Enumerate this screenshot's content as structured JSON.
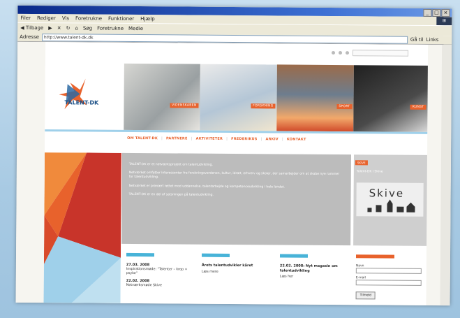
{
  "browser": {
    "menu": [
      "Filer",
      "Rediger",
      "Vis",
      "Foretrukne",
      "Funktioner",
      "Hjælp"
    ],
    "toolbar": [
      "Tilbage",
      "Søg",
      "Foretrukne",
      "Medie"
    ],
    "address_label": "Adresse",
    "address": "http://www.talent-dk.dk",
    "go": "Gå til",
    "links": "Links"
  },
  "logo": {
    "text": "TALENT-DK"
  },
  "banner": {
    "tags": [
      "VIDENSKABEN",
      "FORSKNING",
      "SPORT",
      "KUNST"
    ]
  },
  "nav": [
    "OM TALENT-DK",
    "PARTNERE",
    "AKTIVITETER",
    "FREDERIKUS",
    "ARKIV",
    "KONTAKT"
  ],
  "intro": {
    "p1": "TALENT-DK er et netværksprojekt om talentudvikling.",
    "p2": "Netværket omfatter interessenter fra forskningsverdenen, kultur, idræt, erhverv og skoler, der samarbejder om at skabe nye rammer for talentudvikling.",
    "p3": "Netværket er primært rettet mod uddannelse, talentarbejde og kompetenceudvikling i hele landet.",
    "p4": "TALENT-DK er en del af satsningen på talentudvikling."
  },
  "side": {
    "tag": "SKIVE",
    "caption": "Talent-DK i Skive",
    "town": "Skive"
  },
  "news": [
    {
      "date": "27.03. 2008",
      "text": "Inspirationsmøde: \"Talenter – krop + psyke\"",
      "date2": "22.02. 2008",
      "text2": "Netværksmøde Skive",
      "more": ""
    },
    {
      "date": "",
      "title": "Årets talentudvikler kåret",
      "text": "",
      "more": "Læs mere"
    },
    {
      "date": "",
      "title": "22.02. 2008: Nyt magasin om talentudvikling",
      "text": "",
      "more": "Læs her"
    }
  ],
  "form": {
    "name_label": "Navn",
    "email_label": "E-mail",
    "submit": "Tilmeld"
  },
  "colors": {
    "accent": "#e8622c",
    "blue": "#48b3d8",
    "navy": "#1a4f86"
  }
}
